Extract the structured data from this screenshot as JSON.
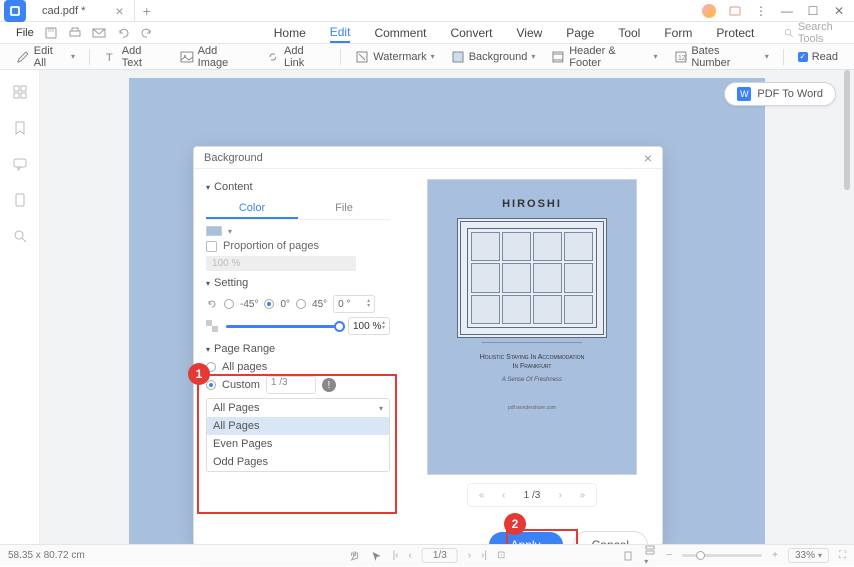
{
  "tab": {
    "filename": "cad.pdf *"
  },
  "menu": {
    "file": "File"
  },
  "main_tabs": [
    "Home",
    "Edit",
    "Comment",
    "Convert",
    "View",
    "Page",
    "Tool",
    "Form",
    "Protect"
  ],
  "main_tab_active": 1,
  "search": {
    "placeholder": "Search Tools"
  },
  "toolbar": {
    "edit_all": "Edit All",
    "add_text": "Add Text",
    "add_image": "Add Image",
    "add_link": "Add Link",
    "watermark": "Watermark",
    "background": "Background",
    "header_footer": "Header & Footer",
    "bates_number": "Bates Number",
    "read": "Read"
  },
  "pdf_to_word": "PDF To Word",
  "dialog": {
    "title": "Background",
    "content": {
      "label": "Content",
      "tab_color": "Color",
      "tab_file": "File",
      "proportion": "Proportion of pages",
      "proportion_value": "100 %"
    },
    "setting": {
      "label": "Setting",
      "neg45": "-45°",
      "zero": "0°",
      "pos45": "45°",
      "angle_value": "0 °",
      "opacity_value": "100 %"
    },
    "page_range": {
      "label": "Page Range",
      "all": "All pages",
      "custom": "Custom",
      "custom_value": "1 /3",
      "dropdown_label": "All Pages",
      "options": [
        "All Pages",
        "Even Pages",
        "Odd Pages"
      ]
    },
    "preview": {
      "title": "HIROSHI",
      "subtitle": "Holistic Staying In Accommodation",
      "subtitle2": "In Frankfurt",
      "italic": "A Sense Of Freshness",
      "domain": "pdf.wondershare.com"
    },
    "pager": {
      "current": "1 /3"
    },
    "apply": "Apply",
    "cancel": "Cancel"
  },
  "annotations": {
    "step1": "1",
    "step2": "2"
  },
  "page_text": {
    "line1": "Holistic Staying In Accommodation",
    "line2": "In Frankfurt"
  },
  "statusbar": {
    "dims": "58.35 x 80.72 cm",
    "page": "1/3",
    "zoom": "33%"
  }
}
